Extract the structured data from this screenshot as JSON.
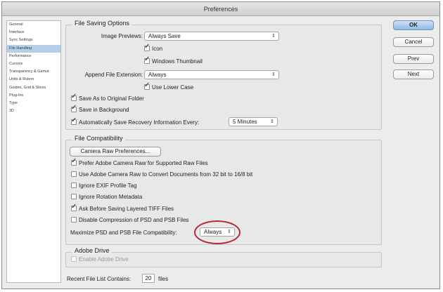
{
  "window": {
    "title": "Preferences"
  },
  "sidebar": {
    "items": [
      {
        "label": "General",
        "selected": false
      },
      {
        "label": "Interface",
        "selected": false
      },
      {
        "label": "Sync Settings",
        "selected": false
      },
      {
        "label": "File Handling",
        "selected": true
      },
      {
        "label": "Performance",
        "selected": false
      },
      {
        "label": "Cursors",
        "selected": false
      },
      {
        "label": "Transparency & Gamut",
        "selected": false
      },
      {
        "label": "Units & Rulers",
        "selected": false
      },
      {
        "label": "Guides, Grid & Slices",
        "selected": false
      },
      {
        "label": "Plug-Ins",
        "selected": false
      },
      {
        "label": "Type",
        "selected": false
      },
      {
        "label": "3D",
        "selected": false
      }
    ]
  },
  "file_saving": {
    "title": "File Saving Options",
    "image_previews_label": "Image Previews:",
    "image_previews_value": "Always Save",
    "icon_label": "Icon",
    "windows_thumbnail_label": "Windows Thumbnail",
    "append_ext_label": "Append File Extension:",
    "append_ext_value": "Always",
    "use_lower_case_label": "Use Lower Case",
    "save_original_folder_label": "Save As to Original Folder",
    "save_background_label": "Save in Background",
    "auto_save_label": "Automatically Save Recovery Information Every:",
    "auto_save_value": "5 Minutes"
  },
  "file_compat": {
    "title": "File Compatibility",
    "camera_raw_button": "Camera Raw Preferences...",
    "prefer_acr_label": "Prefer Adobe Camera Raw for Supported Raw Files",
    "use_acr_convert_label": "Use Adobe Camera Raw to Convert Documents from 32 bit to 16/8 bit",
    "ignore_exif_label": "Ignore EXIF Profile Tag",
    "ignore_rotation_label": "Ignore Rotation Metadata",
    "ask_tiff_label": "Ask Before Saving Layered TIFF Files",
    "disable_compression_label": "Disable Compression of PSD and PSB Files",
    "maximize_label": "Maximize PSD and PSB File Compatibility:",
    "maximize_value": "Always"
  },
  "adobe_drive": {
    "title": "Adobe Drive",
    "enable_label": "Enable Adobe Drive"
  },
  "recent_files": {
    "label": "Recent File List Contains:",
    "value": "20",
    "suffix": "files"
  },
  "buttons": {
    "ok": "OK",
    "cancel": "Cancel",
    "prev": "Prev",
    "next": "Next"
  },
  "colors": {
    "highlight_ring": "#b3273b",
    "selection": "#b5cfe8"
  }
}
